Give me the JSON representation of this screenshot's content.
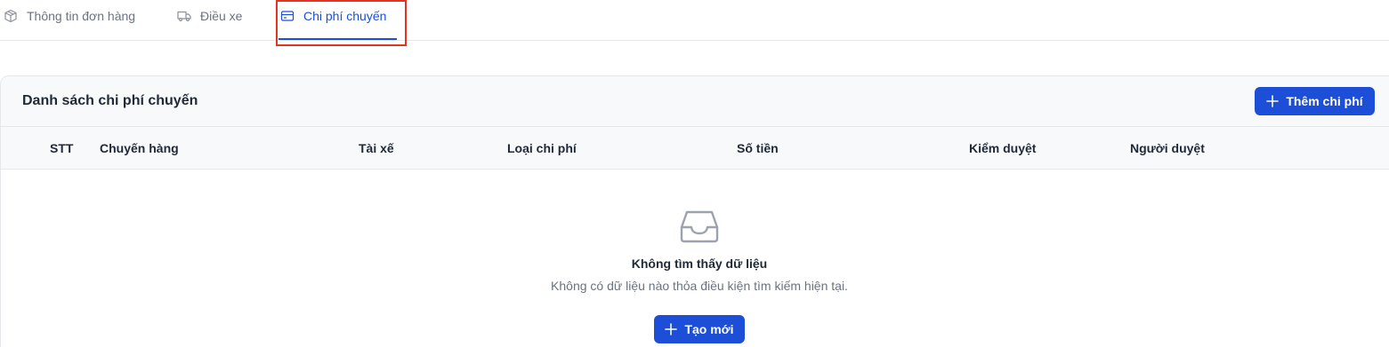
{
  "tabs": [
    {
      "label": "Thông tin đơn hàng",
      "icon": "package-icon"
    },
    {
      "label": "Điều xe",
      "icon": "truck-icon"
    },
    {
      "label": "Chi phí chuyến",
      "icon": "credit-card-icon",
      "active": true
    }
  ],
  "colors": {
    "accent": "#1d4ed8",
    "highlight": "#e53323"
  },
  "costs": {
    "title": "Danh sách chi phí chuyến",
    "add_button": "Thêm chi phí",
    "columns": [
      "STT",
      "Chuyến hàng",
      "Tài xế",
      "Loại chi phí",
      "Số tiền",
      "Kiểm duyệt",
      "Người duyệt"
    ]
  },
  "empty": {
    "icon": "inbox-icon",
    "title": "Không tìm thấy dữ liệu",
    "description": "Không có dữ liệu nào thỏa điều kiện tìm kiếm hiện tại.",
    "create_button": "Tạo mới"
  }
}
